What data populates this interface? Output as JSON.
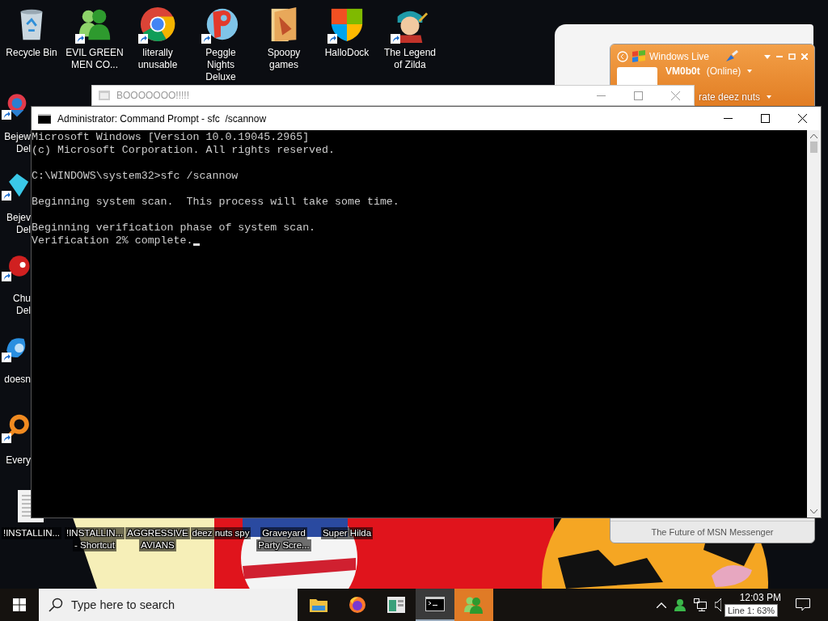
{
  "desktop": {
    "top_icons": [
      {
        "label": "Recycle Bin",
        "kind": "recycle",
        "shortcut": false
      },
      {
        "label": "EVIL GREEN MEN CO...",
        "kind": "people",
        "shortcut": true
      },
      {
        "label": "literally unusable",
        "kind": "browser",
        "shortcut": true
      },
      {
        "label": "Peggle Nights Deluxe",
        "kind": "letter",
        "shortcut": true
      },
      {
        "label": "Spoopy games",
        "kind": "folder",
        "shortcut": false
      },
      {
        "label": "HalloDock",
        "kind": "shield",
        "shortcut": true
      },
      {
        "label": "The Legend of Zilda",
        "kind": "character",
        "shortcut": true
      }
    ],
    "left_icons": [
      {
        "lines": [
          "Bejew",
          "Del"
        ],
        "kind": "gem"
      },
      {
        "lines": [
          "Bejev",
          "Del"
        ],
        "kind": "diamond"
      },
      {
        "lines": [
          "Chu",
          "Del"
        ],
        "kind": "ball"
      },
      {
        "lines": [
          "doesn"
        ],
        "kind": "swirl"
      },
      {
        "lines": [
          "Every"
        ],
        "kind": "ring"
      }
    ],
    "bottom_icons": [
      {
        "lines": [
          "!INSTALLIN..."
        ]
      },
      {
        "lines": [
          "!INSTALLIN...",
          "- Shortcut"
        ]
      },
      {
        "lines": [
          "AGGRESSIVE",
          "AVIANS"
        ]
      },
      {
        "lines": [
          "deez nuts spy"
        ]
      },
      {
        "lines": [
          "Graveyard",
          "Party Scre..."
        ]
      },
      {
        "lines": [
          "Super Hilda"
        ]
      }
    ]
  },
  "messenger": {
    "title": "Windows Live",
    "name": "VM0b0t",
    "status": "(Online)",
    "message": "rate deez nuts",
    "footer": "The Future of MSN Messenger"
  },
  "background_window": {
    "title": "BOOOOOOO!!!!!"
  },
  "console": {
    "title": "Administrator: Command Prompt - sfc  /scannow",
    "blocks": [
      [
        "Microsoft Windows [Version 10.0.19045.2965]",
        "(c) Microsoft Corporation. All rights reserved."
      ],
      [
        "C:\\WINDOWS\\system32>sfc /scannow"
      ],
      [
        "Beginning system scan.  This process will take some time."
      ],
      [
        "Beginning verification phase of system scan.",
        "Verification 2% complete."
      ]
    ]
  },
  "taskbar": {
    "search": {
      "placeholder": "Type here to search"
    },
    "apps": [
      {
        "kind": "folder",
        "selected": false,
        "flashing": false
      },
      {
        "kind": "firefox",
        "selected": false,
        "flashing": false
      },
      {
        "kind": "window",
        "selected": false,
        "flashing": false
      },
      {
        "kind": "console",
        "selected": true,
        "flashing": false
      },
      {
        "kind": "people",
        "selected": false,
        "flashing": true
      }
    ],
    "clock": "12:03 PM",
    "tooltip": "Line 1: 63%"
  }
}
